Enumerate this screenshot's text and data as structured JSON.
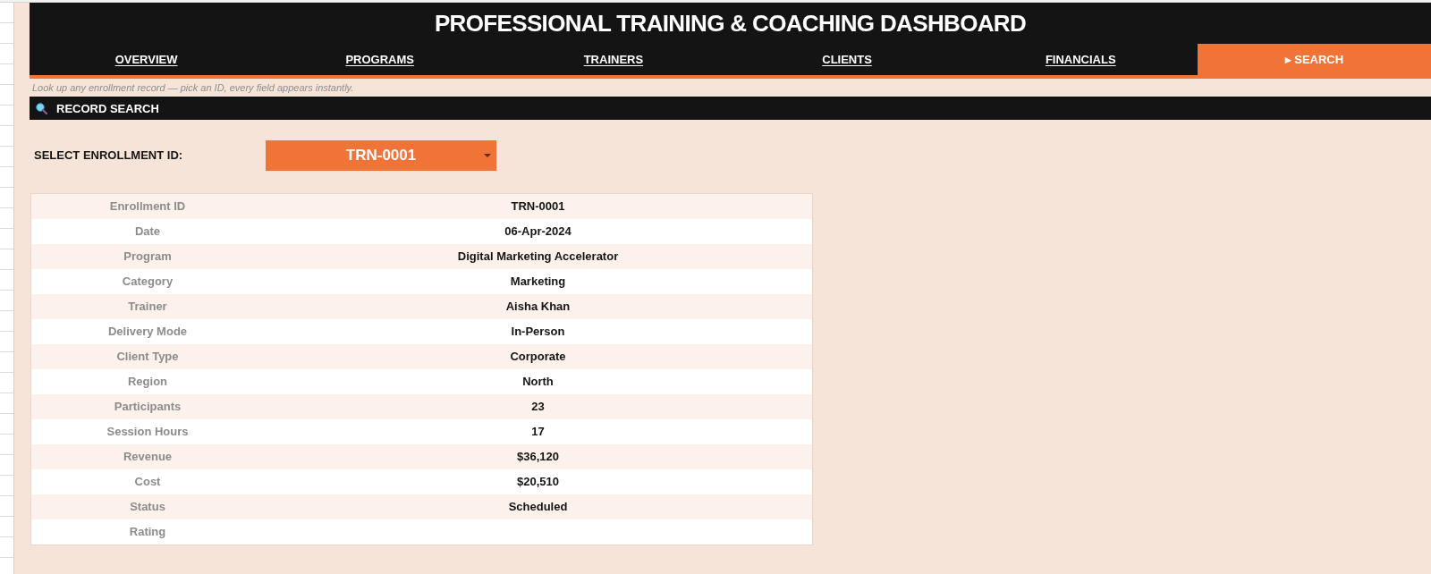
{
  "header": {
    "title": "PROFESSIONAL TRAINING & COACHING DASHBOARD"
  },
  "tabs": [
    {
      "label": "OVERVIEW",
      "selected": false
    },
    {
      "label": "PROGRAMS",
      "selected": false
    },
    {
      "label": "TRAINERS",
      "selected": false
    },
    {
      "label": "CLIENTS",
      "selected": false
    },
    {
      "label": "FINANCIALS",
      "selected": false
    },
    {
      "label": "▸ SEARCH",
      "selected": true
    }
  ],
  "hint": "Look up any enrollment record — pick an ID, every field appears instantly.",
  "section": {
    "title": "RECORD SEARCH"
  },
  "selector": {
    "label": "SELECT ENROLLMENT ID:",
    "value": "TRN-0001"
  },
  "record": [
    {
      "label": "Enrollment ID",
      "value": "TRN-0001"
    },
    {
      "label": "Date",
      "value": "06-Apr-2024"
    },
    {
      "label": "Program",
      "value": "Digital Marketing Accelerator"
    },
    {
      "label": "Category",
      "value": "Marketing"
    },
    {
      "label": "Trainer",
      "value": "Aisha Khan"
    },
    {
      "label": "Delivery Mode",
      "value": "In-Person"
    },
    {
      "label": "Client Type",
      "value": "Corporate"
    },
    {
      "label": "Region",
      "value": "North"
    },
    {
      "label": "Participants",
      "value": "23"
    },
    {
      "label": "Session Hours",
      "value": "17"
    },
    {
      "label": "Revenue",
      "value": "$36,120"
    },
    {
      "label": "Cost",
      "value": "$20,510"
    },
    {
      "label": "Status",
      "value": "Scheduled"
    },
    {
      "label": "Rating"
    }
  ]
}
